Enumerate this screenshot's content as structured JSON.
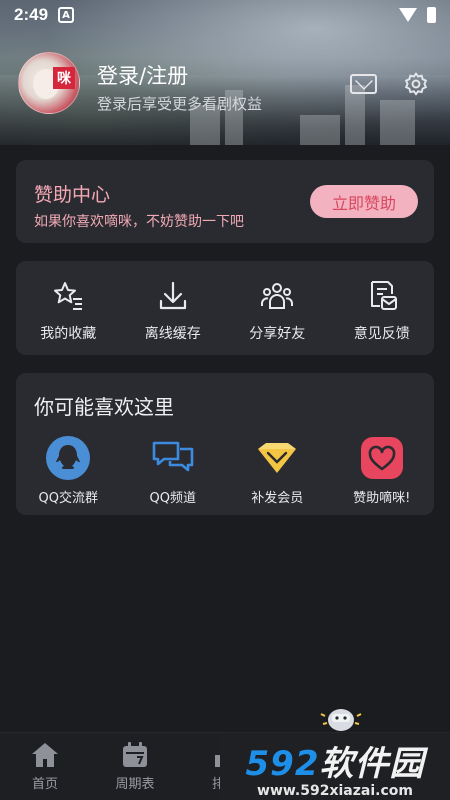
{
  "status_bar": {
    "time": "2:49",
    "notif_icon": "A"
  },
  "profile": {
    "title": "登录/注册",
    "subtitle": "登录后享受更多看剧权益",
    "avatar_mark": "咪"
  },
  "sponsor": {
    "title": "赞助中心",
    "desc": "如果你喜欢嘀咪，不妨赞助一下吧",
    "button": "立即赞助"
  },
  "features": [
    {
      "label": "我的收藏",
      "icon": "star-list-icon"
    },
    {
      "label": "离线缓存",
      "icon": "download-icon"
    },
    {
      "label": "分享好友",
      "icon": "people-icon"
    },
    {
      "label": "意见反馈",
      "icon": "feedback-icon"
    }
  ],
  "recommend": {
    "heading": "你可能喜欢这里",
    "items": [
      {
        "label": "QQ交流群",
        "icon": "qq-icon"
      },
      {
        "label": "QQ频道",
        "icon": "chat-bubbles-icon"
      },
      {
        "label": "补发会员",
        "icon": "diamond-icon"
      },
      {
        "label": "赞助嘀咪!",
        "icon": "heart-icon"
      }
    ]
  },
  "tabs": [
    {
      "label": "首页",
      "icon": "home-icon"
    },
    {
      "label": "周期表",
      "icon": "calendar-icon"
    },
    {
      "label": "排行",
      "icon": "ranking-icon"
    }
  ],
  "watermark": {
    "brand_num": "592",
    "brand_text": "软件园",
    "url": "www.592xiazai.com"
  },
  "colors": {
    "accent_pink": "#f5a8b5",
    "button_bg": "#f2b2bf",
    "background": "#1b1c20",
    "card": "#2a2b30",
    "qq_blue": "#4a8fd6",
    "diamond_yellow": "#f3c542",
    "heart_red": "#e8455e"
  }
}
